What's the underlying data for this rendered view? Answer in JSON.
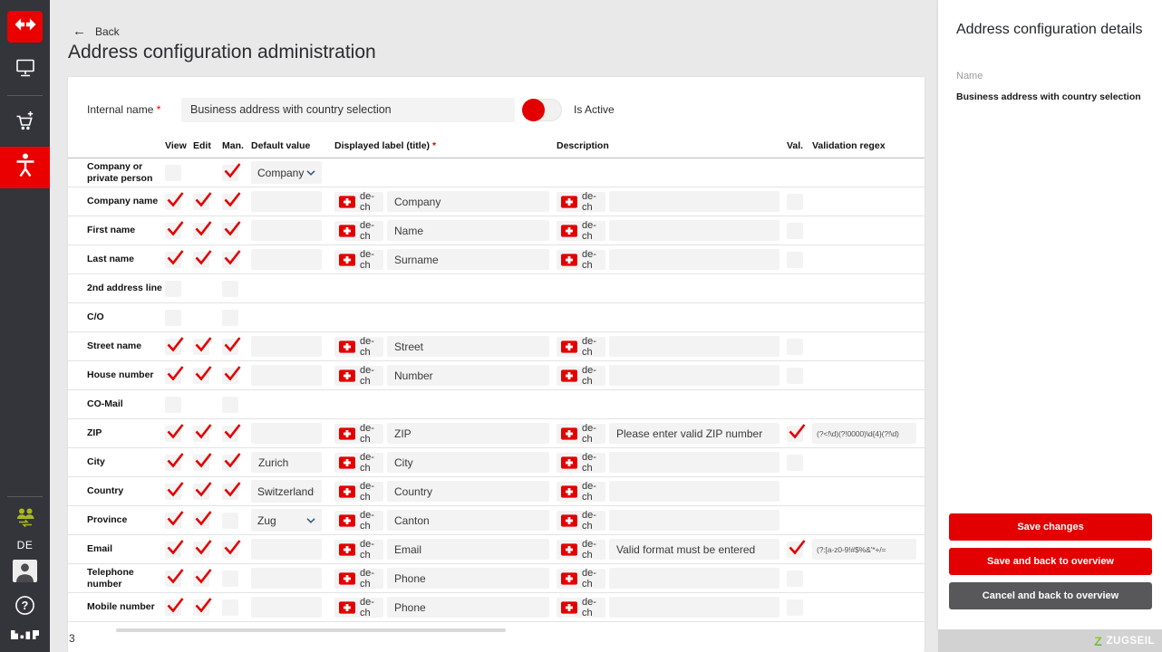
{
  "colors": {
    "accent": "#eb0000",
    "check": "#e30000",
    "button_red": "#e30000",
    "button_gray": "#58585b",
    "brand_green": "#a9b821"
  },
  "sidebar": {
    "language_label": "DE"
  },
  "header": {
    "back_label": "Back",
    "title": "Address configuration administration"
  },
  "form": {
    "internal_name_label": "Internal name",
    "required_marker": "*",
    "internal_name_value": "Business address with country selection",
    "is_active_label": "Is Active"
  },
  "table": {
    "headers": {
      "view": "View",
      "edit": "Edit",
      "man": "Man.",
      "default": "Default value",
      "displayed": "Displayed label (title)",
      "description": "Description",
      "val": "Val.",
      "regex": "Validation regex"
    },
    "required_marker": "*",
    "flag_label": "de-ch",
    "rows": [
      {
        "label": "Company or private person",
        "view": "empty",
        "edit": "none",
        "man": "checked",
        "default": {
          "type": "select",
          "value": "Company"
        },
        "display_label": null,
        "description": null,
        "val": "none",
        "regex": null
      },
      {
        "label": "Company name",
        "view": "checked",
        "edit": "checked",
        "man": "checked",
        "default": {
          "type": "input",
          "value": ""
        },
        "display_label": "Company",
        "description": "",
        "val": "empty",
        "regex": null
      },
      {
        "label": "First name",
        "view": "checked",
        "edit": "checked",
        "man": "checked",
        "default": {
          "type": "input",
          "value": ""
        },
        "display_label": "Name",
        "description": "",
        "val": "empty",
        "regex": null
      },
      {
        "label": "Last name",
        "view": "checked",
        "edit": "checked",
        "man": "checked",
        "default": {
          "type": "input",
          "value": ""
        },
        "display_label": "Surname",
        "description": "",
        "val": "empty",
        "regex": null
      },
      {
        "label": "2nd address line",
        "view": "empty",
        "edit": "none",
        "man": "empty",
        "default": null,
        "display_label": null,
        "description": null,
        "val": "none",
        "regex": null
      },
      {
        "label": "C/O",
        "view": "empty",
        "edit": "none",
        "man": "empty",
        "default": null,
        "display_label": null,
        "description": null,
        "val": "none",
        "regex": null
      },
      {
        "label": "Street name",
        "view": "checked",
        "edit": "checked",
        "man": "checked",
        "default": {
          "type": "input",
          "value": ""
        },
        "display_label": "Street",
        "description": "",
        "val": "empty",
        "regex": null
      },
      {
        "label": "House number",
        "view": "checked",
        "edit": "checked",
        "man": "checked",
        "default": {
          "type": "input",
          "value": ""
        },
        "display_label": "Number",
        "description": "",
        "val": "empty",
        "regex": null
      },
      {
        "label": "CO-Mail",
        "view": "empty",
        "edit": "none",
        "man": "empty",
        "default": null,
        "display_label": null,
        "description": null,
        "val": "none",
        "regex": null
      },
      {
        "label": "ZIP",
        "view": "checked",
        "edit": "checked",
        "man": "checked",
        "default": {
          "type": "input",
          "value": ""
        },
        "display_label": "ZIP",
        "description": "Please enter valid ZIP number",
        "val": "checked",
        "regex": "(?<!\\d)(?!0000)\\d{4}(?!\\d)"
      },
      {
        "label": "City",
        "view": "checked",
        "edit": "checked",
        "man": "checked",
        "default": {
          "type": "input",
          "value": "Zurich"
        },
        "display_label": "City",
        "description": "",
        "val": "empty",
        "regex": null
      },
      {
        "label": "Country",
        "view": "checked",
        "edit": "checked",
        "man": "checked",
        "default": {
          "type": "select",
          "value": "Switzerland"
        },
        "display_label": "Country",
        "description": "",
        "val": "none",
        "regex": null
      },
      {
        "label": "Province",
        "view": "checked",
        "edit": "checked",
        "man": "empty",
        "default": {
          "type": "select",
          "value": "Zug"
        },
        "display_label": "Canton",
        "description": "",
        "val": "none",
        "regex": null
      },
      {
        "label": "Email",
        "view": "checked",
        "edit": "checked",
        "man": "checked",
        "default": {
          "type": "input",
          "value": ""
        },
        "display_label": "Email",
        "description": "Valid format must be entered",
        "val": "checked",
        "regex": "(?:[a-z0-9!#$%&'*+/="
      },
      {
        "label": "Telephone number",
        "view": "checked",
        "edit": "checked",
        "man": "empty",
        "default": {
          "type": "input",
          "value": ""
        },
        "display_label": "Phone",
        "description": "",
        "val": "empty",
        "regex": null
      },
      {
        "label": "Mobile number",
        "view": "checked",
        "edit": "checked",
        "man": "empty",
        "default": {
          "type": "input",
          "value": ""
        },
        "display_label": "Phone",
        "description": "",
        "val": "empty",
        "regex": null
      }
    ]
  },
  "details": {
    "title": "Address configuration details",
    "name_label": "Name",
    "name_value": "Business address with country selection",
    "buttons": [
      {
        "label": "Save changes",
        "style": "red"
      },
      {
        "label": "Save and back to overview",
        "style": "red"
      },
      {
        "label": "Cancel and back to overview",
        "style": "gray"
      }
    ]
  },
  "footer": {
    "brand_initial": "Z",
    "brand": "ZUGSEIL",
    "partial_text": "3"
  }
}
